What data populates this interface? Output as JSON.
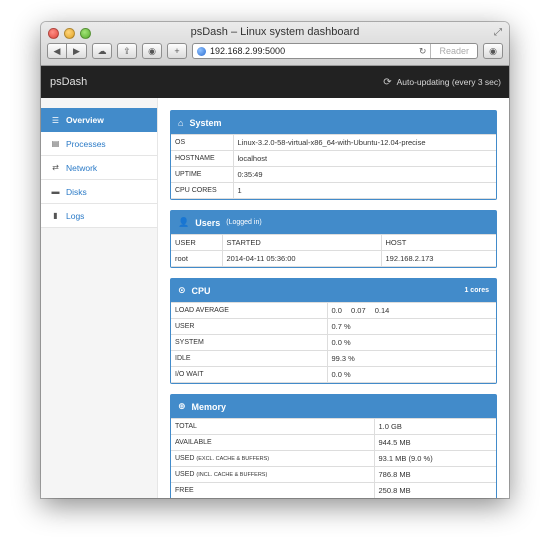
{
  "window": {
    "title": "psDash – Linux system dashboard",
    "url": "192.168.2.99:5000",
    "reader_label": "Reader"
  },
  "app": {
    "brand": "psDash",
    "auto_update": "Auto-updating (every 3 sec)"
  },
  "sidebar": {
    "items": [
      {
        "label": "Overview",
        "icon": "list-icon",
        "active": true
      },
      {
        "label": "Processes",
        "icon": "processes-icon",
        "active": false
      },
      {
        "label": "Network",
        "icon": "arrows-icon",
        "active": false
      },
      {
        "label": "Disks",
        "icon": "disk-icon",
        "active": false
      },
      {
        "label": "Logs",
        "icon": "file-icon",
        "active": false
      }
    ]
  },
  "system": {
    "title": "System",
    "rows": [
      {
        "label": "OS",
        "value": "Linux-3.2.0-58-virtual-x86_64-with-Ubuntu-12.04-precise"
      },
      {
        "label": "HOSTNAME",
        "value": "localhost"
      },
      {
        "label": "UPTIME",
        "value": "0:35:49"
      },
      {
        "label": "CPU CORES",
        "value": "1"
      }
    ]
  },
  "users": {
    "title": "Users",
    "subtitle": "(Logged in)",
    "headers": [
      "USER",
      "STARTED",
      "HOST"
    ],
    "rows": [
      [
        "root",
        "2014-04-11 05:36:00",
        "192.168.2.173"
      ]
    ]
  },
  "cpu": {
    "title": "CPU",
    "cores_label": "1 cores",
    "load_label": "LOAD AVERAGE",
    "load_values": [
      "0.0",
      "0.07",
      "0.14"
    ],
    "rows": [
      {
        "label": "USER",
        "value": "0.7 %"
      },
      {
        "label": "SYSTEM",
        "value": "0.0 %"
      },
      {
        "label": "IDLE",
        "value": "99.3 %"
      },
      {
        "label": "I/O WAIT",
        "value": "0.0 %"
      }
    ]
  },
  "memory": {
    "title": "Memory",
    "rows": [
      {
        "label": "TOTAL",
        "note": "",
        "value": "1.0 GB"
      },
      {
        "label": "AVAILABLE",
        "note": "",
        "value": "944.5 MB"
      },
      {
        "label": "USED",
        "note": "(EXCL. CACHE & BUFFERS)",
        "value": "93.1 MB (9.0 %)"
      },
      {
        "label": "USED",
        "note": "(INCL. CACHE & BUFFERS)",
        "value": "786.8 MB"
      },
      {
        "label": "FREE",
        "note": "",
        "value": "250.8 MB"
      }
    ]
  }
}
